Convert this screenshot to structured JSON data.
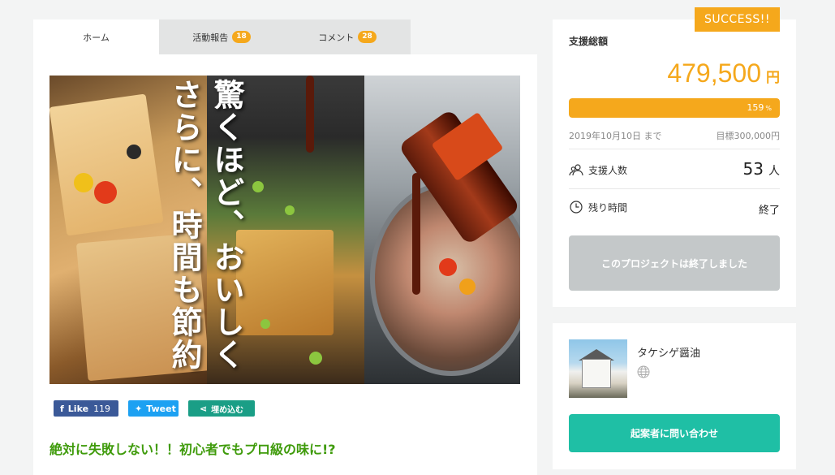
{
  "tabs": [
    {
      "label": "ホーム",
      "badge": null
    },
    {
      "label": "活動報告",
      "badge": "18"
    },
    {
      "label": "コメント",
      "badge": "28"
    }
  ],
  "hero": {
    "overlay_text_col1": "驚くほど、おいしく",
    "overlay_text_col2": "さらに、時間も節約"
  },
  "social": {
    "facebook_label": "Like",
    "facebook_count": "119",
    "twitter_label": "Tweet",
    "embed_label": "埋め込む"
  },
  "headline": "絶対に失敗しない！！初心者でもプロ級の味に!?",
  "status_badge": "SUCCESS!!",
  "funding": {
    "total_label": "支援総額",
    "amount": "479,500",
    "currency": "円",
    "percent": "159",
    "percent_unit": "%",
    "progress_fraction": 1.0,
    "deadline": "2019年10月10日 まで",
    "goal": "目標300,000円",
    "backers_label": "支援人数",
    "backers_count": "53",
    "backers_unit": "人",
    "remaining_label": "残り時間",
    "remaining_value": "終了",
    "ended_button": "このプロジェクトは終了しました"
  },
  "owner": {
    "name": "タケシゲ醤油",
    "contact_button": "起案者に問い合わせ"
  },
  "colors": {
    "accent": "#f5a81c",
    "headline": "#3f9b0b",
    "contact": "#1fbfa5",
    "disabled": "#c4c8c9"
  },
  "icons": [
    "users-icon",
    "clock-icon",
    "globe-icon",
    "facebook-icon",
    "twitter-icon",
    "share-icon"
  ]
}
